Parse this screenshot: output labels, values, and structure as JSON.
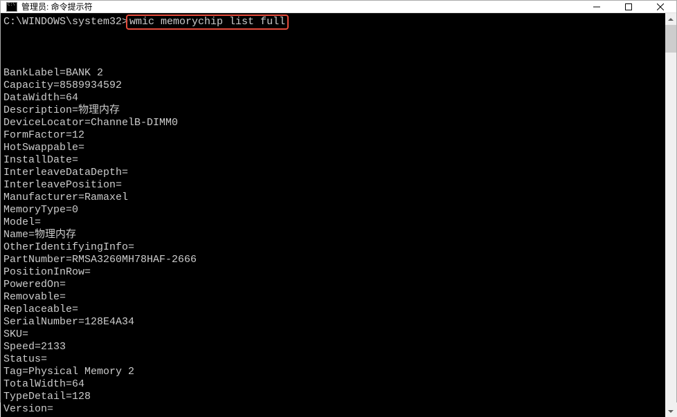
{
  "titlebar": {
    "title": "管理员: 命令提示符"
  },
  "console": {
    "prompt": "C:\\WINDOWS\\system32>",
    "command": "wmic memorychip list full",
    "blank1": "",
    "blank2": "",
    "output": {
      "BankLabel": "BankLabel=BANK 2",
      "Capacity": "Capacity=8589934592",
      "DataWidth": "DataWidth=64",
      "Description": "Description=物理内存",
      "DeviceLocator": "DeviceLocator=ChannelB-DIMM0",
      "FormFactor": "FormFactor=12",
      "HotSwappable": "HotSwappable=",
      "InstallDate": "InstallDate=",
      "InterleaveDataDepth": "InterleaveDataDepth=",
      "InterleavePosition": "InterleavePosition=",
      "Manufacturer": "Manufacturer=Ramaxel",
      "MemoryType": "MemoryType=0",
      "Model": "Model=",
      "Name": "Name=物理内存",
      "OtherIdentifyingInfo": "OtherIdentifyingInfo=",
      "PartNumber": "PartNumber=RMSA3260MH78HAF-2666",
      "PositionInRow": "PositionInRow=",
      "PoweredOn": "PoweredOn=",
      "Removable": "Removable=",
      "Replaceable": "Replaceable=",
      "SerialNumber": "SerialNumber=128E4A34",
      "SKU": "SKU=",
      "Speed": "Speed=2133",
      "Status": "Status=",
      "Tag": "Tag=Physical Memory 2",
      "TotalWidth": "TotalWidth=64",
      "TypeDetail": "TypeDetail=128",
      "Version": "Version="
    }
  }
}
